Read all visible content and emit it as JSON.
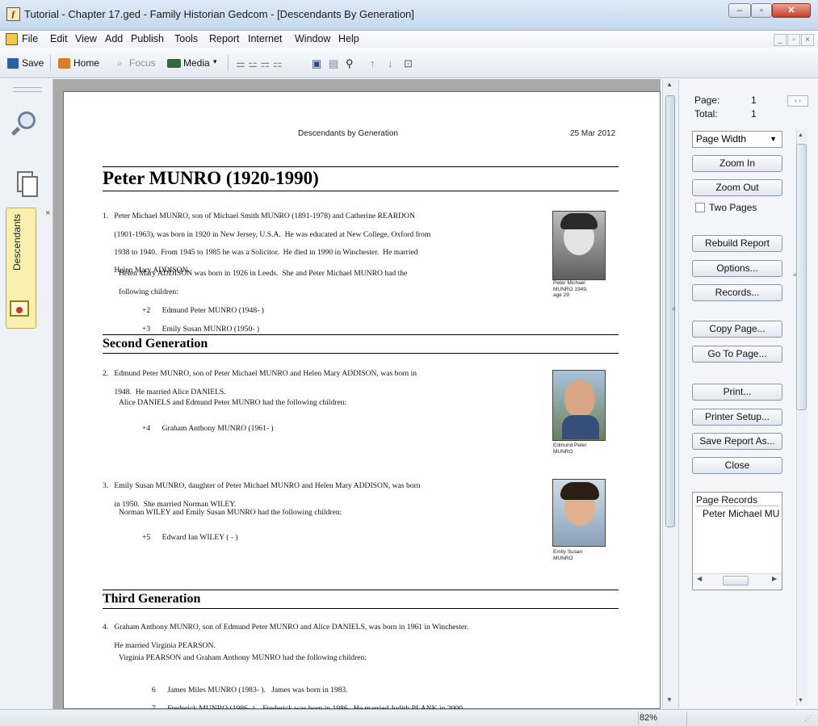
{
  "window": {
    "title": "Tutorial - Chapter 17.ged - Family Historian Gedcom - [Descendants By Generation]",
    "minimize": "–",
    "maximize": "▫",
    "close": "✕"
  },
  "menu": [
    "File",
    "Edit",
    "View",
    "Add",
    "Publish",
    "Tools",
    "Report",
    "Internet",
    "Window",
    "Help"
  ],
  "mdi_controls": [
    "_",
    "▫",
    "×"
  ],
  "toolbar": {
    "save": "Save",
    "home": "Home",
    "focus": "Focus",
    "media": "Media"
  },
  "left_panel": {
    "tab_label": "Descendants",
    "tab_close": "×"
  },
  "report": {
    "header_title": "Descendants by Generation",
    "header_date": "25 Mar 2012",
    "main_title": "Peter MUNRO (1920-1990)",
    "gen1": {
      "lines": [
        "1.   Peter Michael MUNRO, son of Michael Smith MUNRO (1891-1978) and Catherine REARDON",
        "      (1901-1963), was born in 1920 in New Jersey, U.S.A.  He was educated at New College, Oxford from",
        "      1938 to 1940.  From 1945 to 1985 he was a Solicitor.  He died in 1990 in Winchester.  He married",
        "      Helen Mary ADDISON."
      ],
      "spouse_text": [
        "Helen Mary ADDISON was born in 1926 in Leeds.  She and Peter Michael MUNRO had the",
        "following children:"
      ],
      "children": [
        "+2      Edmund Peter MUNRO (1948- )",
        "+3      Emily Susan MUNRO (1950- )"
      ],
      "photo_caption": [
        "Peter Michael",
        "MUNRO 1949,",
        "age 29"
      ]
    },
    "second_generation": "Second Generation",
    "gen2a": {
      "lines": [
        "2.   Edmund Peter MUNRO, son of Peter Michael MUNRO and Helen Mary ADDISON, was born in",
        "      1948.  He married Alice DANIELS."
      ],
      "spouse_text": "Alice DANIELS and Edmund Peter MUNRO had the following children:",
      "children": [
        "+4      Graham Anthony MUNRO (1961- )"
      ],
      "photo_caption": [
        "Edmund Peter",
        "MUNRO"
      ]
    },
    "gen2b": {
      "lines": [
        "3.   Emily Susan MUNRO, daughter of Peter Michael MUNRO and Helen Mary ADDISON, was born",
        "      in 1950.  She married Norman WILEY."
      ],
      "spouse_text": "Norman WILEY and Emily Susan MUNRO had the following children:",
      "children": [
        "+5      Edward Ian WILEY ( - )"
      ],
      "photo_caption": [
        "Emily Susan",
        "MUNRO"
      ]
    },
    "third_generation": "Third Generation",
    "gen3": {
      "lines": [
        "4.   Graham Anthony MUNRO, son of Edmund Peter MUNRO and Alice DANIELS, was born in 1961 in Winchester.",
        "      He married Virginia PEARSON."
      ],
      "spouse_text": "Virginia PEARSON and Graham Anthony MUNRO had the following children:",
      "children": [
        "6      James Miles MUNRO (1983- ).   James was born in 1983.",
        "7      Frederick MUNRO (1986- ).   Frederick was born in 1986.  He married Judith PLANK in 2000."
      ]
    }
  },
  "right_panel": {
    "page_label": "Page:",
    "page_value": "1",
    "total_label": "Total:",
    "total_value": "1",
    "zoom_select": "Page Width",
    "zoom_in": "Zoom In",
    "zoom_out": "Zoom Out",
    "two_pages": "Two Pages",
    "rebuild_report": "Rebuild Report",
    "options": "Options...",
    "records": "Records...",
    "copy_page": "Copy Page...",
    "go_to_page": "Go To Page...",
    "print": "Print...",
    "printer_setup": "Printer Setup...",
    "save_report_as": "Save Report As...",
    "close": "Close",
    "page_records_label": "Page Records",
    "page_records_item": "Peter Michael MU"
  },
  "status": {
    "zoom": "82%"
  },
  "colors": {
    "accent": "#3a6ea5",
    "page_bg": "#a9a9a9",
    "side_tab": "#fbefb0"
  }
}
